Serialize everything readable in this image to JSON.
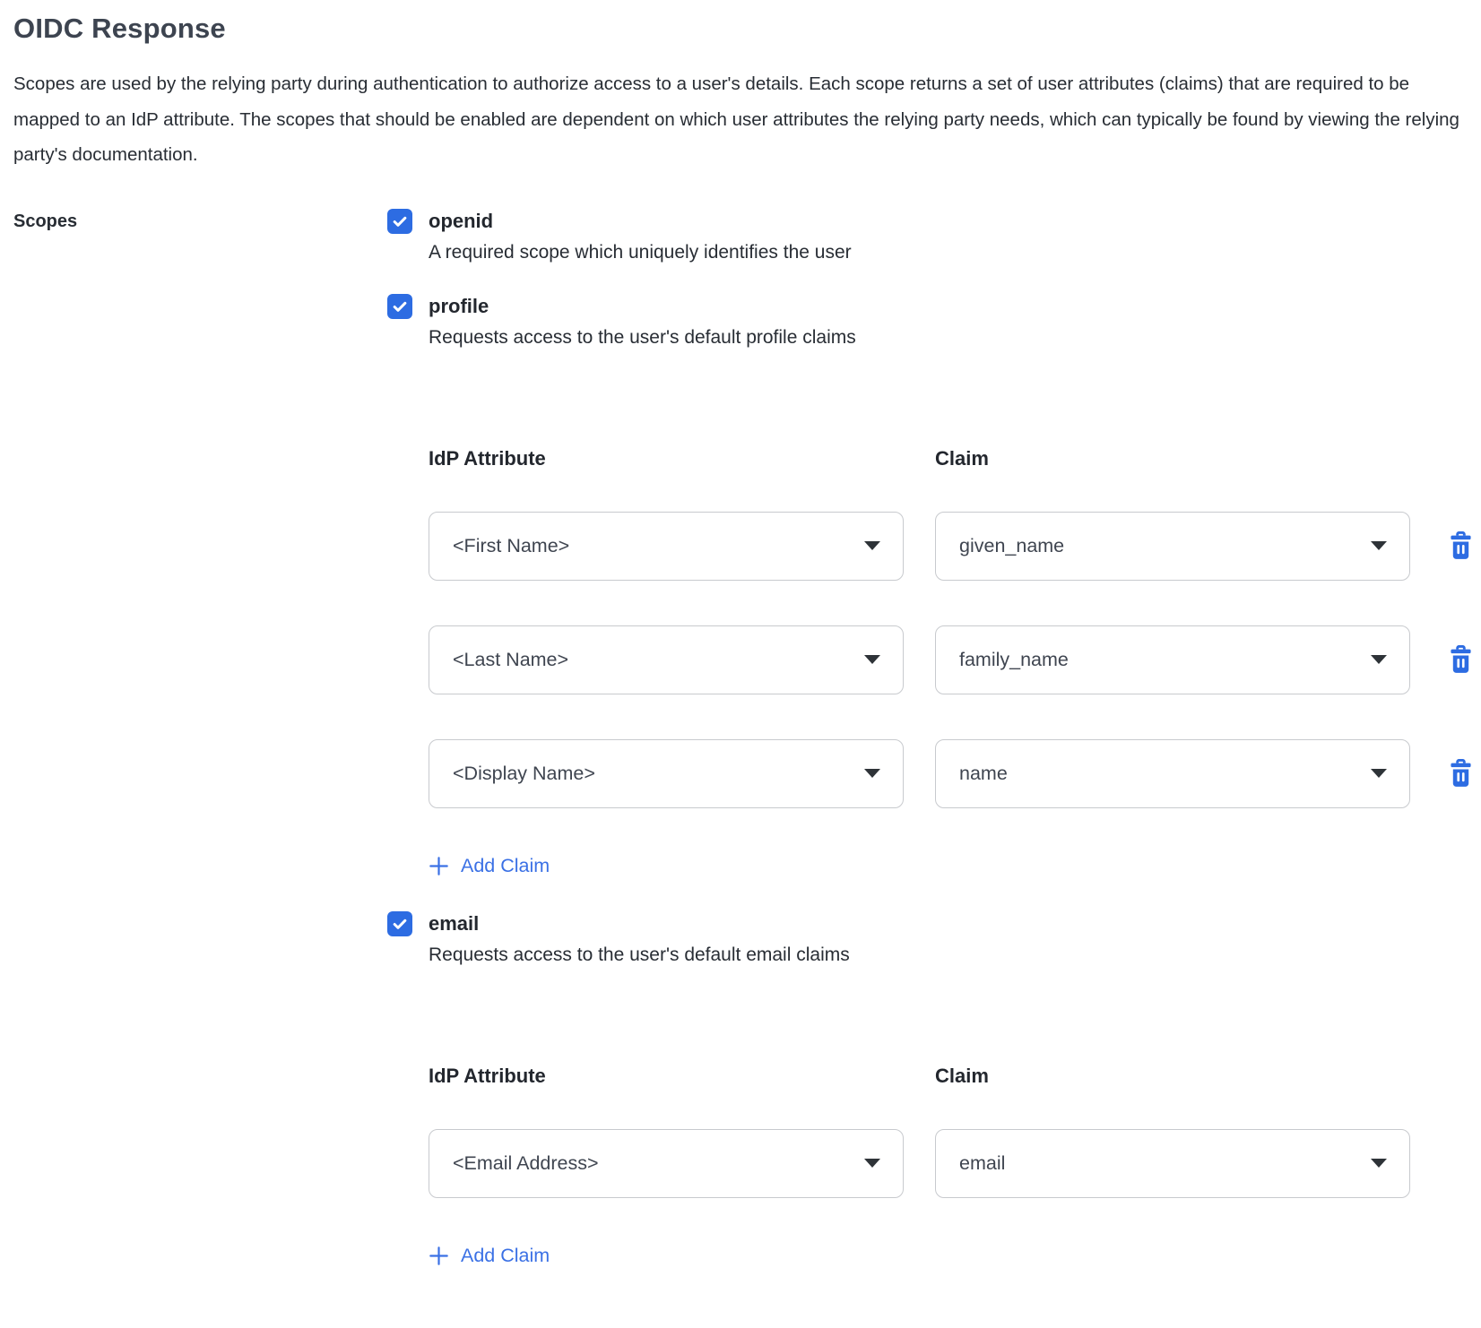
{
  "title": "OIDC Response",
  "description": "Scopes are used by the relying party during authentication to authorize access to a user's details. Each scope returns a set of user attributes (claims) that are required to be mapped to an IdP attribute. The scopes that should be enabled are dependent on which user attributes the relying party needs, which can typically be found by viewing the relying party's documentation.",
  "scopes_label": "Scopes",
  "table": {
    "idp_header": "IdP Attribute",
    "claim_header": "Claim",
    "add_claim_label": "Add Claim"
  },
  "scopes": [
    {
      "name": "openid",
      "checked": true,
      "description": "A required scope which uniquely identifies the user"
    },
    {
      "name": "profile",
      "checked": true,
      "description": "Requests access to the user's default profile claims",
      "claims": [
        {
          "idp": "<First Name>",
          "claim": "given_name"
        },
        {
          "idp": "<Last Name>",
          "claim": "family_name"
        },
        {
          "idp": "<Display Name>",
          "claim": "name"
        }
      ]
    },
    {
      "name": "email",
      "checked": true,
      "description": "Requests access to the user's default email claims",
      "claims": [
        {
          "idp": "<Email Address>",
          "claim": "email"
        }
      ]
    }
  ],
  "colors": {
    "accent": "#2d6ce2",
    "link": "#3a70e5"
  }
}
